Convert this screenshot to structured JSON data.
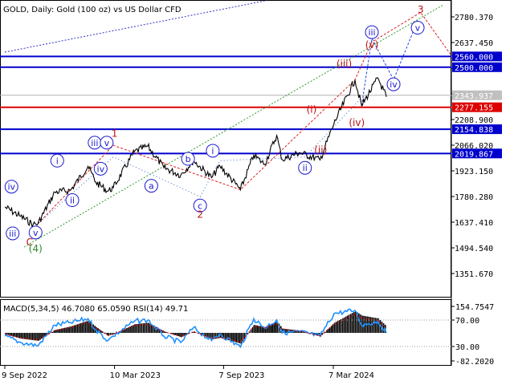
{
  "header": {
    "title": "GOLD, Daily:  Gold (100 oz) vs US Dollar CFD"
  },
  "chart_data": [
    {
      "type": "line",
      "title": "GOLD, Daily:  Gold (100 oz) vs US Dollar CFD",
      "x_ticks": [
        "9 Sep 2022",
        "10 Mar 2023",
        "7 Sep 2023",
        "7 Mar 2024"
      ],
      "y_ticks": [
        2780.37,
        2637.45,
        2494.54,
        2351.62,
        2208.9,
        2066.02,
        1923.15,
        1780.28,
        1637.41,
        1494.54,
        1351.67
      ],
      "ylim": [
        1280,
        2850
      ],
      "grid": false,
      "current_price": 2343.937,
      "series": [
        {
          "x": [
            "2022-09-09",
            "2022-10-05",
            "2022-10-26",
            "2022-11-03",
            "2022-12-01",
            "2022-12-27",
            "2023-01-25",
            "2023-02-07",
            "2023-02-27",
            "2023-03-08",
            "2023-04-12",
            "2023-05-04",
            "2023-05-31",
            "2023-06-28",
            "2023-07-19",
            "2023-08-18",
            "2023-09-01",
            "2023-10-05",
            "2023-10-27",
            "2023-11-14",
            "2023-12-04",
            "2023-12-13",
            "2024-01-11",
            "2024-02-14",
            "2024-03-08",
            "2024-04-12",
            "2024-04-23",
            "2024-05-20",
            "2024-06-03"
          ],
          "values": [
            1722,
            1670,
            1625,
            1629,
            1805,
            1815,
            1948,
            1860,
            1810,
            1830,
            2030,
            2060,
            1940,
            1900,
            1980,
            1885,
            1950,
            1818,
            2010,
            1960,
            2120,
            1985,
            2025,
            1984,
            2185,
            2430,
            2285,
            2440,
            2335
          ]
        }
      ],
      "levels": [
        {
          "label": "2560.000",
          "value": 2560.0,
          "color": "#0000cc"
        },
        {
          "label": "2500.000",
          "value": 2500.0,
          "color": "#0000cc"
        },
        {
          "label": "2277.155",
          "value": 2277.155,
          "color": "#dd0000"
        },
        {
          "label": "2154.838",
          "value": 2154.838,
          "color": "#0000cc"
        },
        {
          "label": "2019.867",
          "value": 2019.867,
          "color": "#0000cc"
        }
      ],
      "wave_labels": [
        {
          "text": "iv",
          "date": "2022-09-20",
          "price": "1835",
          "style": "blue-circle"
        },
        {
          "text": "iii",
          "date": "2022-09-22",
          "price": "1575",
          "style": "blue-circle"
        },
        {
          "text": "v",
          "date": "2022-10-30",
          "price": "1580",
          "style": "blue-circle"
        },
        {
          "text": "C",
          "date": "2022-10-20",
          "price": "1525",
          "style": "red"
        },
        {
          "text": "(4)",
          "date": "2022-10-30",
          "price": "1490",
          "style": "green"
        },
        {
          "text": "i",
          "date": "2022-12-05",
          "price": "1980",
          "style": "blue-circle"
        },
        {
          "text": "ii",
          "date": "2022-12-30",
          "price": "1760",
          "style": "blue-circle"
        },
        {
          "text": "iii",
          "date": "2023-02-05",
          "price": "2080",
          "style": "blue-circle"
        },
        {
          "text": "v",
          "date": "2023-02-25",
          "price": "2080",
          "style": "blue-circle"
        },
        {
          "text": "iv",
          "date": "2023-02-15",
          "price": "1935",
          "style": "blue-circle"
        },
        {
          "text": "1",
          "date": "2023-03-10",
          "price": "2130",
          "style": "red"
        },
        {
          "text": "a",
          "date": "2023-05-10",
          "price": "1840",
          "style": "blue-circle"
        },
        {
          "text": "b",
          "date": "2023-07-10",
          "price": "1990",
          "style": "blue-circle"
        },
        {
          "text": "c",
          "date": "2023-07-30",
          "price": "1730",
          "style": "blue-circle"
        },
        {
          "text": "2",
          "date": "2023-07-30",
          "price": "1680",
          "style": "red"
        },
        {
          "text": "i",
          "date": "2023-08-20",
          "price": "2035",
          "style": "blue-circle"
        },
        {
          "text": "ii",
          "date": "2024-01-20",
          "price": "1940",
          "style": "blue-circle"
        },
        {
          "text": "(ii)",
          "date": "2024-02-15",
          "price": "2040",
          "style": "red"
        },
        {
          "text": "(i)",
          "date": "2024-01-31",
          "price": "2265",
          "style": "red"
        },
        {
          "text": "(iii)",
          "date": "2024-03-25",
          "price": "2520",
          "style": "red"
        },
        {
          "text": "(iv)",
          "date": "2024-04-15",
          "price": "2190",
          "style": "red"
        },
        {
          "text": "iii",
          "date": "2024-05-10",
          "price": "2695",
          "style": "blue-circle"
        },
        {
          "text": "(v)",
          "date": "2024-05-10",
          "price": "2625",
          "style": "red"
        },
        {
          "text": "iv",
          "date": "2024-06-15",
          "price": "2405",
          "style": "blue-circle"
        },
        {
          "text": "v",
          "date": "2024-07-25",
          "price": "2720",
          "style": "blue-circle"
        },
        {
          "text": "3",
          "date": "2024-07-30",
          "price": "2820",
          "style": "red"
        }
      ]
    },
    {
      "type": "bar",
      "title": "MACD(5,34,5) 46.7080 65.0590 RSI(14) 49.71",
      "y_ticks": [
        "154.7547",
        "70.00",
        "30.00",
        "-82.2020"
      ],
      "macd_hist": [
        {
          "x": "2022-09-09",
          "value": -10
        },
        {
          "x": "2022-10-05",
          "value": -40
        },
        {
          "x": "2022-11-03",
          "value": -55
        },
        {
          "x": "2022-12-01",
          "value": 20
        },
        {
          "x": "2022-12-27",
          "value": 45
        },
        {
          "x": "2023-01-25",
          "value": 85
        },
        {
          "x": "2023-02-07",
          "value": 40
        },
        {
          "x": "2023-02-27",
          "value": -20
        },
        {
          "x": "2023-03-08",
          "value": -10
        },
        {
          "x": "2023-04-12",
          "value": 60
        },
        {
          "x": "2023-05-04",
          "value": 70
        },
        {
          "x": "2023-05-31",
          "value": 10
        },
        {
          "x": "2023-06-28",
          "value": -30
        },
        {
          "x": "2023-07-19",
          "value": 10
        },
        {
          "x": "2023-08-18",
          "value": -45
        },
        {
          "x": "2023-09-01",
          "value": -35
        },
        {
          "x": "2023-10-05",
          "value": -75
        },
        {
          "x": "2023-10-27",
          "value": 55
        },
        {
          "x": "2023-11-14",
          "value": 40
        },
        {
          "x": "2023-12-04",
          "value": 80
        },
        {
          "x": "2023-12-13",
          "value": 30
        },
        {
          "x": "2024-01-11",
          "value": 15
        },
        {
          "x": "2024-02-14",
          "value": -25
        },
        {
          "x": "2024-03-08",
          "value": 70
        },
        {
          "x": "2024-04-12",
          "value": 150
        },
        {
          "x": "2024-04-23",
          "value": 120
        },
        {
          "x": "2024-05-20",
          "value": 100
        },
        {
          "x": "2024-06-03",
          "value": 45
        }
      ],
      "rsi": [
        {
          "x": "2022-09-09",
          "value": 45
        },
        {
          "x": "2022-10-05",
          "value": 35
        },
        {
          "x": "2022-11-03",
          "value": 30
        },
        {
          "x": "2022-12-01",
          "value": 62
        },
        {
          "x": "2022-12-27",
          "value": 66
        },
        {
          "x": "2023-01-25",
          "value": 72
        },
        {
          "x": "2023-02-07",
          "value": 55
        },
        {
          "x": "2023-02-27",
          "value": 38
        },
        {
          "x": "2023-03-08",
          "value": 45
        },
        {
          "x": "2023-04-12",
          "value": 68
        },
        {
          "x": "2023-05-04",
          "value": 70
        },
        {
          "x": "2023-05-31",
          "value": 45
        },
        {
          "x": "2023-06-28",
          "value": 35
        },
        {
          "x": "2023-07-19",
          "value": 58
        },
        {
          "x": "2023-08-18",
          "value": 38
        },
        {
          "x": "2023-09-01",
          "value": 48
        },
        {
          "x": "2023-10-05",
          "value": 28
        },
        {
          "x": "2023-10-27",
          "value": 72
        },
        {
          "x": "2023-11-14",
          "value": 58
        },
        {
          "x": "2023-12-04",
          "value": 70
        },
        {
          "x": "2023-12-13",
          "value": 50
        },
        {
          "x": "2024-01-11",
          "value": 52
        },
        {
          "x": "2024-02-14",
          "value": 45
        },
        {
          "x": "2024-03-08",
          "value": 80
        },
        {
          "x": "2024-04-12",
          "value": 85
        },
        {
          "x": "2024-04-23",
          "value": 62
        },
        {
          "x": "2024-05-20",
          "value": 68
        },
        {
          "x": "2024-06-03",
          "value": 49.71
        }
      ]
    }
  ]
}
